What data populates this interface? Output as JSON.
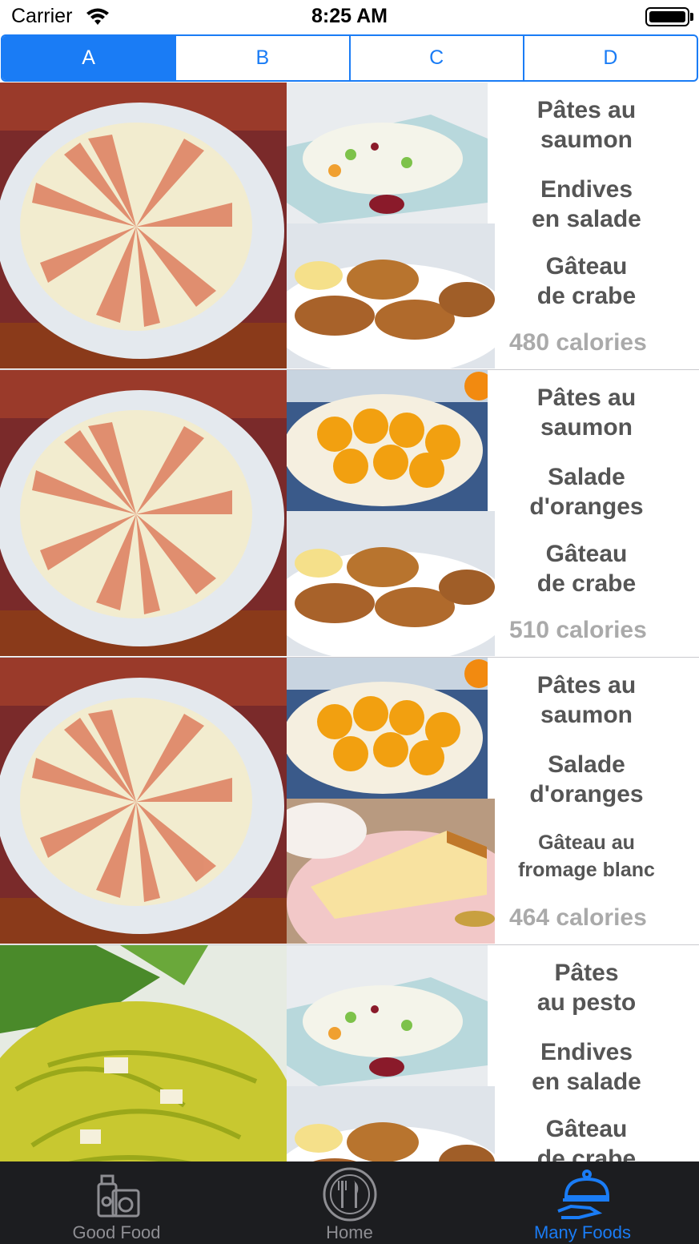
{
  "status_bar": {
    "carrier": "Carrier",
    "time": "8:25 AM"
  },
  "segments": [
    {
      "label": "A",
      "selected": true
    },
    {
      "label": "B",
      "selected": false
    },
    {
      "label": "C",
      "selected": false
    },
    {
      "label": "D",
      "selected": false
    }
  ],
  "menus": [
    {
      "main_image": "salmon-pasta-photo",
      "top_image": "endive-salad-photo",
      "bottom_image": "crab-cake-photo",
      "dish1": [
        "Pâtes au",
        "saumon"
      ],
      "dish2": [
        "Endives",
        "en salade"
      ],
      "dish3": [
        "Gâteau",
        "de crabe"
      ],
      "calories": "480 calories"
    },
    {
      "main_image": "salmon-pasta-photo",
      "top_image": "orange-salad-photo",
      "bottom_image": "crab-cake-photo",
      "dish1": [
        "Pâtes au",
        "saumon"
      ],
      "dish2": [
        "Salade",
        "d'oranges"
      ],
      "dish3": [
        "Gâteau",
        "de crabe"
      ],
      "calories": "510 calories"
    },
    {
      "main_image": "salmon-pasta-photo",
      "top_image": "orange-salad-photo",
      "bottom_image": "cheesecake-photo",
      "dish1": [
        "Pâtes au",
        "saumon"
      ],
      "dish2": [
        "Salade",
        "d'oranges"
      ],
      "dish3": [
        "Gâteau au",
        "fromage blanc"
      ],
      "calories": "464 calories"
    },
    {
      "main_image": "pesto-pasta-photo",
      "top_image": "endive-salad-photo",
      "bottom_image": "crab-cake-photo",
      "dish1": [
        "Pâtes",
        "au pesto"
      ],
      "dish2": [
        "Endives",
        "en salade"
      ],
      "dish3": [
        "Gâteau",
        "de crabe"
      ],
      "calories": ""
    }
  ],
  "tab_bar": {
    "items": [
      {
        "label": "Good Food",
        "icon": "grocery-icon",
        "active": false
      },
      {
        "label": "Home",
        "icon": "plate-cutlery-icon",
        "active": false
      },
      {
        "label": "Many Foods",
        "icon": "cloche-serving-icon",
        "active": true
      }
    ]
  },
  "colors": {
    "accent": "#1a7cf5",
    "tab_bar_bg": "#1c1d20",
    "dish_text": "#555555",
    "calorie_text": "#aaaaaa"
  }
}
